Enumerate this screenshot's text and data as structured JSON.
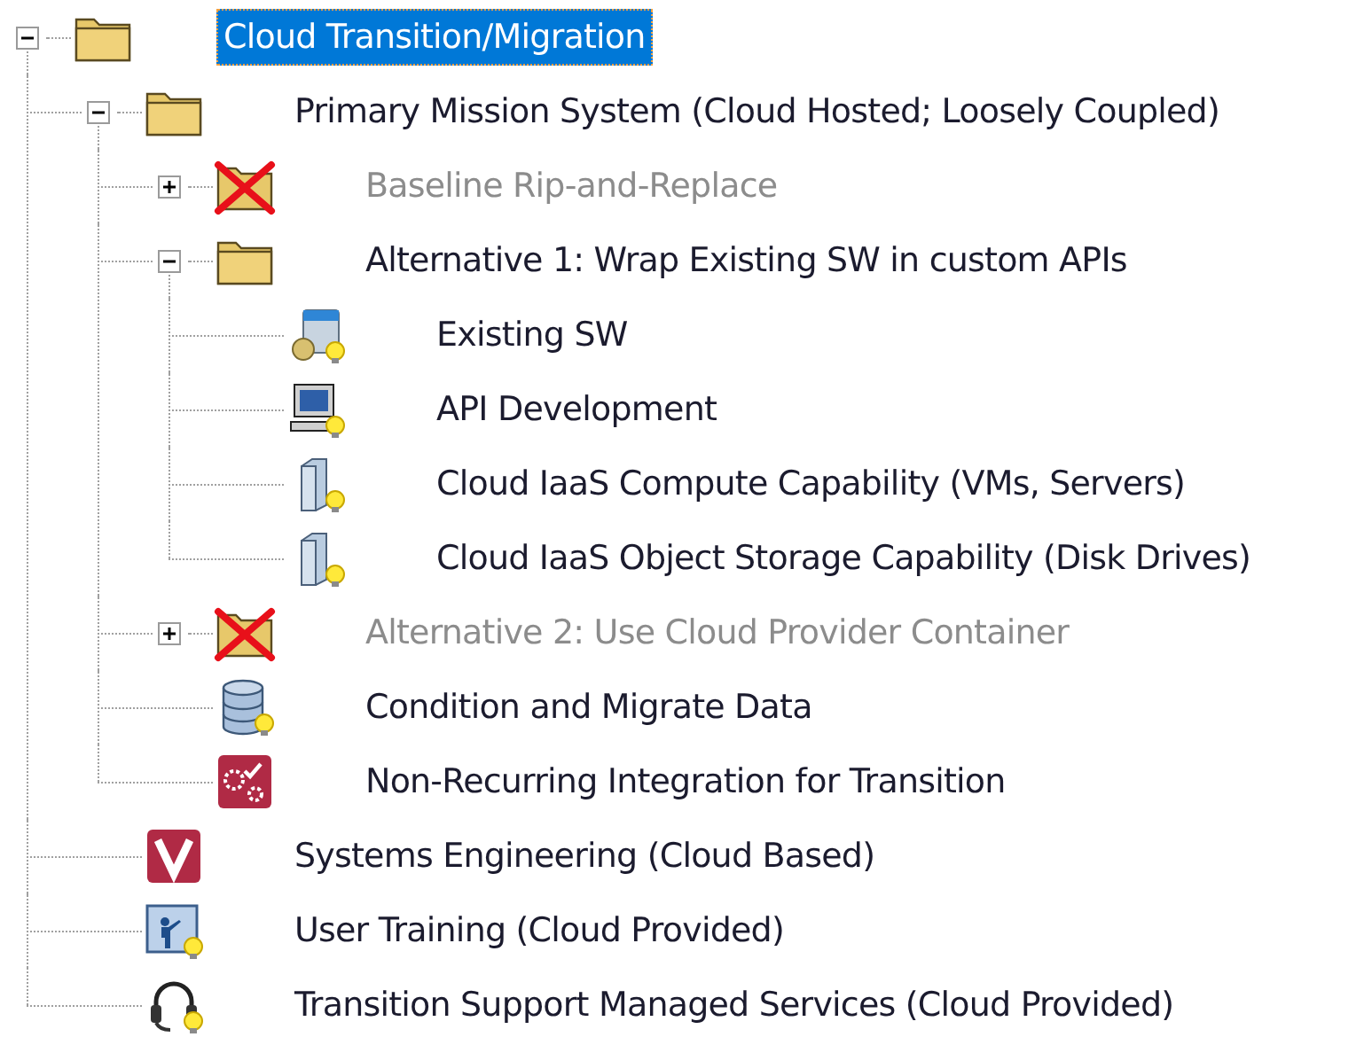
{
  "tree": [
    {
      "label": "Cloud Transition/Migration",
      "kind": "folder",
      "expanded": true,
      "selected": true,
      "disabled": false,
      "children": [
        {
          "label": "Primary Mission System (Cloud Hosted; Loosely Coupled)",
          "kind": "folder",
          "expanded": true,
          "selected": false,
          "disabled": false,
          "children": [
            {
              "label": "Baseline Rip-and-Replace",
              "kind": "excluded",
              "expanded": false,
              "selected": false,
              "disabled": true
            },
            {
              "label": "Alternative 1: Wrap Existing SW in custom APIs",
              "kind": "folder",
              "expanded": true,
              "selected": false,
              "disabled": false,
              "children": [
                {
                  "label": "Existing SW",
                  "kind": "software",
                  "selected": false,
                  "disabled": false
                },
                {
                  "label": "API Development",
                  "kind": "computer",
                  "selected": false,
                  "disabled": false
                },
                {
                  "label": "Cloud IaaS Compute Capability (VMs, Servers)",
                  "kind": "server",
                  "selected": false,
                  "disabled": false
                },
                {
                  "label": "Cloud IaaS Object Storage Capability (Disk Drives)",
                  "kind": "server",
                  "selected": false,
                  "disabled": false
                }
              ]
            },
            {
              "label": "Alternative 2: Use Cloud Provider Container",
              "kind": "excluded",
              "expanded": false,
              "selected": false,
              "disabled": true
            },
            {
              "label": "Condition and Migrate Data",
              "kind": "database",
              "selected": false,
              "disabled": false
            },
            {
              "label": "Non-Recurring Integration for Transition",
              "kind": "integration",
              "selected": false,
              "disabled": false
            }
          ]
        },
        {
          "label": "Systems Engineering (Cloud Based)",
          "kind": "engineering",
          "selected": false,
          "disabled": false
        },
        {
          "label": "User Training (Cloud Provided)",
          "kind": "training",
          "selected": false,
          "disabled": false
        },
        {
          "label": "Transition Support Managed Services (Cloud Provided)",
          "kind": "service",
          "selected": false,
          "disabled": false
        }
      ]
    }
  ]
}
